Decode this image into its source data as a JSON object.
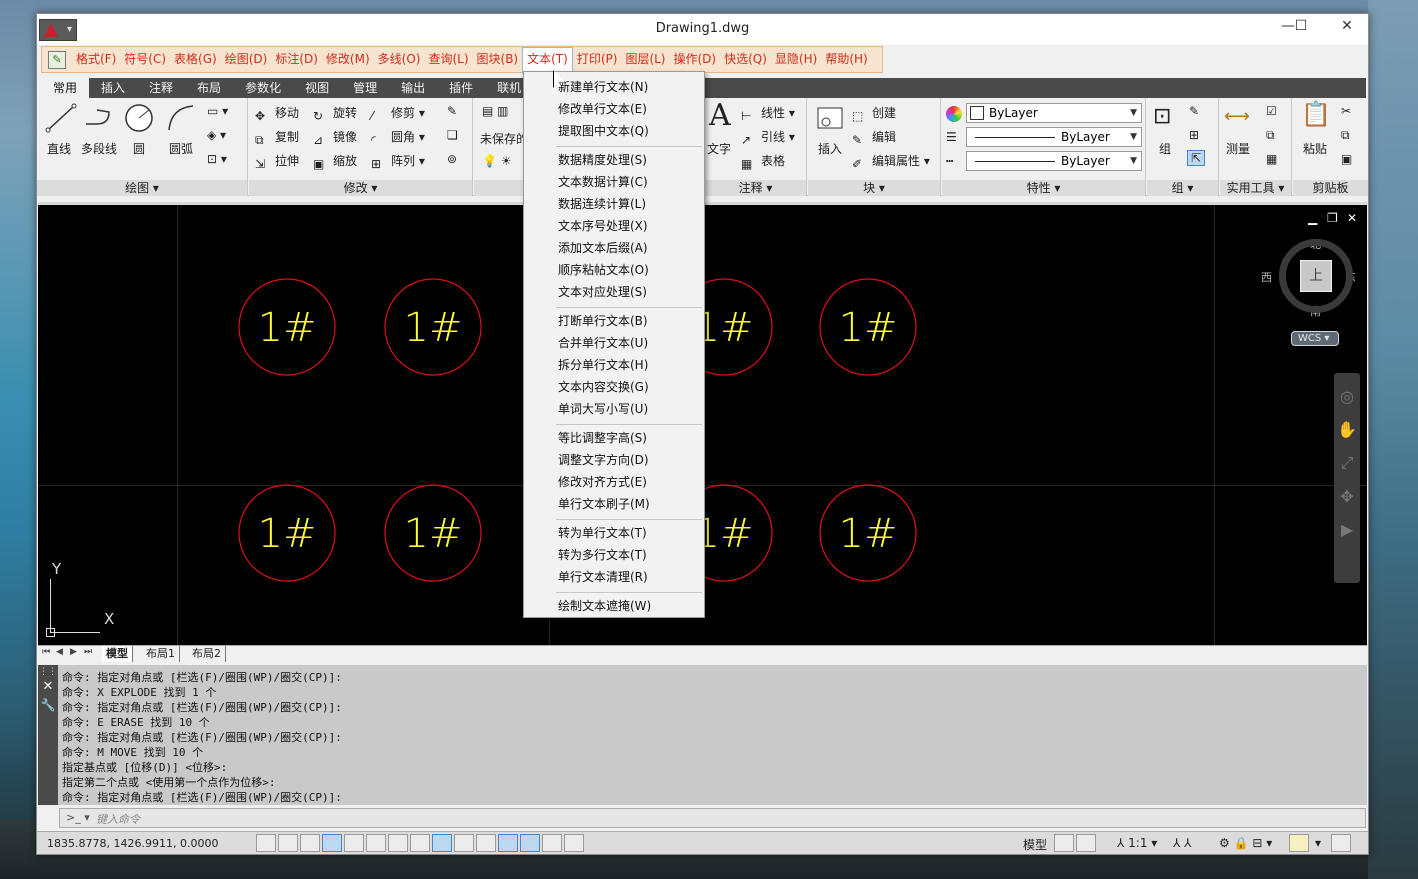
{
  "window": {
    "title": "Drawing1.dwg",
    "minimize": "—",
    "maximize": "☐",
    "close": "✕"
  },
  "menubar": {
    "items": [
      "格式(F)",
      "符号(C)",
      "表格(G)",
      "绘图(D)",
      "标注(D)",
      "修改(M)",
      "多线(O)",
      "查询(L)",
      "图块(B)",
      "文本(T)",
      "打印(P)",
      "图层(L)",
      "操作(D)",
      "快选(Q)",
      "显隐(H)",
      "帮助(H)"
    ],
    "active": "文本(T)"
  },
  "ribbon_tabs": [
    "常用",
    "插入",
    "注释",
    "布局",
    "参数化",
    "视图",
    "管理",
    "输出",
    "插件",
    "联机"
  ],
  "ribbon": {
    "draw": {
      "title": "绘图 ▾",
      "line": "直线",
      "polyline": "多段线",
      "circle": "圆",
      "arc": "圆弧"
    },
    "modify": {
      "title": "修改 ▾",
      "move": "移动",
      "rotate": "旋转",
      "trim": "修剪 ▾",
      "copy": "复制",
      "mirror": "镜像",
      "fillet": "圆角 ▾",
      "stretch": "拉伸",
      "scale": "缩放",
      "array": "阵列 ▾"
    },
    "layer": {
      "unsaved": "未保存的"
    },
    "annotation": {
      "title": "注释 ▾",
      "text": "文字",
      "linear": "线性 ▾",
      "leader": "引线 ▾",
      "table": "表格"
    },
    "block": {
      "title": "块 ▾",
      "insert": "插入",
      "create": "创建",
      "edit": "编辑",
      "edit_attr": "编辑属性 ▾"
    },
    "properties": {
      "title": "特性 ▾",
      "color": "ByLayer",
      "linetype": "ByLayer",
      "lineweight": "ByLayer"
    },
    "group": {
      "title": "组 ▾",
      "group": "组"
    },
    "utilities": {
      "title": "实用工具 ▾",
      "measure": "测量"
    },
    "clipboard": {
      "title": "剪贴板",
      "paste": "粘贴"
    }
  },
  "text_menu": {
    "groups": [
      [
        "新建单行文本(N)",
        "修改单行文本(E)",
        "提取图中文本(Q)"
      ],
      [
        "数据精度处理(S)",
        "文本数据计算(C)",
        "数据连续计算(L)",
        "文本序号处理(X)",
        "添加文本后缀(A)",
        "顺序粘帖文本(O)",
        "文本对应处理(S)"
      ],
      [
        "打断单行文本(B)",
        "合并单行文本(U)",
        "拆分单行文本(H)",
        "文本内容交换(G)",
        "单词大写小写(U)"
      ],
      [
        "等比调整字高(S)",
        "调整文字方向(D)",
        "修改对齐方式(E)",
        "单行文本刷子(M)"
      ],
      [
        "转为单行文本(T)",
        "转为多行文本(T)",
        "单行文本清理(R)"
      ],
      [
        "绘制文本遮掩(W)"
      ]
    ]
  },
  "drawing": {
    "circle_label": "1#",
    "viewcube": {
      "north": "北",
      "south": "南",
      "east": "东",
      "west": "西",
      "top": "上"
    },
    "wcs": "WCS",
    "ucs_x": "X",
    "ucs_y": "Y"
  },
  "layout_tabs": [
    "模型",
    "布局1",
    "布局2"
  ],
  "command_history": [
    "命令: 指定对角点或 [栏选(F)/圈围(WP)/圈交(CP)]:",
    "命令: X EXPLODE 找到 1 个",
    "命令: 指定对角点或 [栏选(F)/圈围(WP)/圈交(CP)]:",
    "命令: E ERASE 找到 10 个",
    "命令: 指定对角点或 [栏选(F)/圈围(WP)/圈交(CP)]:",
    "命令: M MOVE 找到 10 个",
    "指定基点或 [位移(D)] <位移>:",
    "指定第二个点或 <使用第一个点作为位移>:",
    "命令: 指定对角点或 [栏选(F)/圈围(WP)/圈交(CP)]:"
  ],
  "command_input_placeholder": "键入命令",
  "status": {
    "coords": "1835.8778, 1426.9911, 0.0000",
    "model": "模型",
    "scale": "1:1"
  },
  "colors": {
    "circle": "#e0101a",
    "text": "#ffff33",
    "menu_text": "#d62a1a"
  }
}
